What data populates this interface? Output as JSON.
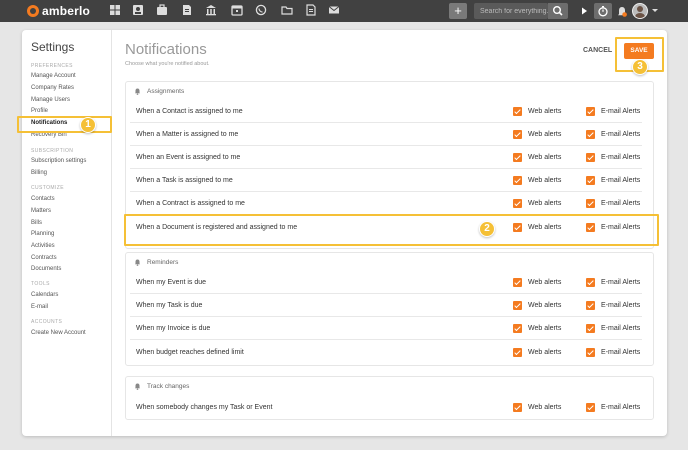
{
  "topbar": {
    "brand": "amberlo",
    "search_placeholder": "Search for everything...",
    "nav_icons": [
      "dashboard-icon",
      "contacts-icon",
      "matters-icon",
      "documents-icon",
      "bills-icon",
      "calendar-icon",
      "phone-icon",
      "folder-icon",
      "notes-icon",
      "email-icon"
    ],
    "plus_label": "+"
  },
  "sidebar": {
    "title": "Settings",
    "sections": [
      {
        "header": "PREFERENCES",
        "items": [
          "Manage Account",
          "Company Rates",
          "Manage Users",
          "Profile",
          "Notifications",
          "Recovery Bin"
        ]
      },
      {
        "header": "SUBSCRIPTION",
        "items": [
          "Subscription settings",
          "Billing"
        ]
      },
      {
        "header": "CUSTOMIZE",
        "items": [
          "Contacts",
          "Matters",
          "Bills",
          "Planning",
          "Activities",
          "Contracts",
          "Documents"
        ]
      },
      {
        "header": "TOOLS",
        "items": [
          "Calendars",
          "E-mail"
        ]
      },
      {
        "header": "ACCOUNTS",
        "items": [
          "Create New Account"
        ]
      }
    ],
    "active_item": "Notifications"
  },
  "main": {
    "title": "Notifications",
    "subtitle": "Choose what you're notified about.",
    "cancel_label": "CANCEL",
    "save_label": "SAVE",
    "web_label": "Web alerts",
    "email_label": "E-mail Alerts",
    "panels": [
      {
        "title": "Assignments",
        "rows": [
          {
            "label": "When a Contact is assigned to me",
            "web": true,
            "email": true
          },
          {
            "label": "When a Matter is assigned to me",
            "web": true,
            "email": true
          },
          {
            "label": "When an Event is assigned to me",
            "web": true,
            "email": true
          },
          {
            "label": "When a Task is assigned to me",
            "web": true,
            "email": true
          },
          {
            "label": "When a Contract is assigned to me",
            "web": true,
            "email": true
          },
          {
            "label": "When a Document is registered and assigned to me",
            "web": true,
            "email": true
          }
        ]
      },
      {
        "title": "Reminders",
        "rows": [
          {
            "label": "When my Event is due",
            "web": true,
            "email": true
          },
          {
            "label": "When my Task is due",
            "web": true,
            "email": true
          },
          {
            "label": "When my Invoice is due",
            "web": true,
            "email": true
          },
          {
            "label": "When budget reaches defined limit",
            "web": true,
            "email": true
          }
        ]
      },
      {
        "title": "Track changes",
        "rows": [
          {
            "label": "When somebody changes my Task or Event",
            "web": true,
            "email": true
          }
        ]
      }
    ]
  },
  "annotations": {
    "step1": "1",
    "step2": "2",
    "step3": "3",
    "highlight_color": "#f5c036"
  },
  "colors": {
    "accent": "#f47b20",
    "topbar": "#414141"
  }
}
